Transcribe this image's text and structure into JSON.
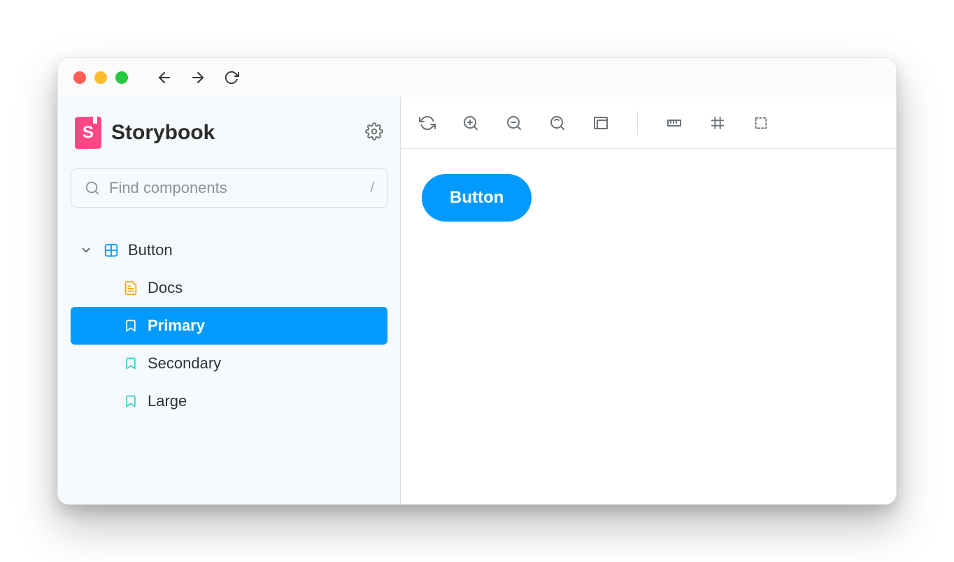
{
  "brand": {
    "name": "Storybook",
    "logo_letter": "S"
  },
  "search": {
    "placeholder": "Find components",
    "shortcut": "/"
  },
  "sidebar": {
    "component": {
      "label": "Button"
    },
    "items": [
      {
        "label": "Docs",
        "kind": "docs",
        "selected": false
      },
      {
        "label": "Primary",
        "kind": "story",
        "selected": true
      },
      {
        "label": "Secondary",
        "kind": "story",
        "selected": false
      },
      {
        "label": "Large",
        "kind": "story",
        "selected": false
      }
    ]
  },
  "canvas": {
    "demo_button_label": "Button"
  },
  "colors": {
    "accent": "#029bfd",
    "brand": "#ff4785",
    "docs_icon": "#f5a623",
    "component_icon": "#029bfd",
    "story_icon": "#2dd4bf"
  }
}
